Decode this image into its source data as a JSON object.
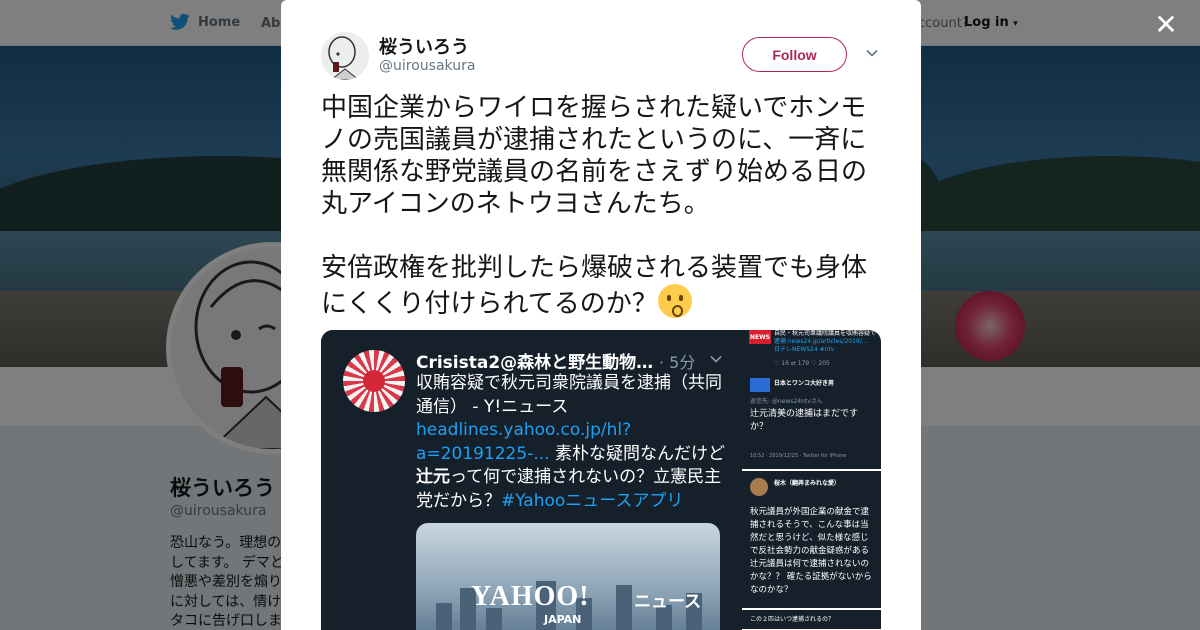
{
  "nav": {
    "home": "Home",
    "about": "Abo",
    "account_prompt": "ccount?",
    "login": "Log in"
  },
  "profile": {
    "name": "桜ういろう",
    "handle": "@uirousakura",
    "bio_lines": [
      "恐山なう。理想の",
      "してます。 デマと",
      "憎悪や差別を煽り",
      "に対しては、情け",
      "タコに告げ口しま"
    ]
  },
  "tweet": {
    "name": "桜ういろう",
    "handle": "@uirousakura",
    "follow_label": "Follow",
    "text": "中国企業からワイロを握らされた疑いでホンモノの売国議員が逮捕されたというのに、一斉に無関係な野党議員の名前をさえずり始める日の丸アイコンのネトウヨさんたち。\n\n安倍政権を批判したら爆破される装置でも身体にくくり付けられてるのか？",
    "emoji_icon": "hushed-face-emoji",
    "brand_color": "#b2284f"
  },
  "media": {
    "embedded_tweet": {
      "name": "Crisista2@森林と野生動物…",
      "time": "· 5分",
      "text_before_link": "収賄容疑で秋元司衆院議員を逮捕（共同通信） - Y!ニュース",
      "link": "headlines.yahoo.co.jp/hl?a=20191225-...",
      "text_mid": " 素朴な疑問なんだけど",
      "bold": "辻元",
      "text_after": "って何で逮捕されないの？立憲民主党だから？",
      "hashtag": "#Yahooニュースアプリ",
      "card_logo": "YAHOO!",
      "card_news": "ニュース",
      "card_japan": "JAPAN"
    },
    "thumb1": {
      "badge": "NEWS",
      "line1": "自民・秋元司衆議院議員を収賄容疑で",
      "line2": "逮捕 news24.jp/articles/2019/…",
      "line3": "日テレNEWS24 #ntv",
      "stats": "♡ 16   ⇄ 179   ♡ 205",
      "user": "日本とワンコ大好き男",
      "reply_to": "返信先: @news24ntvさん",
      "body": "辻元清美の逮捕はまだですか？",
      "footer": "10:52 · 2019/12/25 · Twitter for iPhone"
    },
    "thumb2": {
      "user": "桜木（翻弄まみれな愛）",
      "body": "秋元議員が外国企業の献金で逮捕されるそうで、こんな事は当然だと思うけど、似た様な感じで反社会勢力の献金疑惑がある辻元議員は何で逮捕されないのかな？？ 確たる証拠がないからなのかな？"
    },
    "thumb3": {
      "body": "この２匹はいつ逮捕されるの？"
    }
  }
}
